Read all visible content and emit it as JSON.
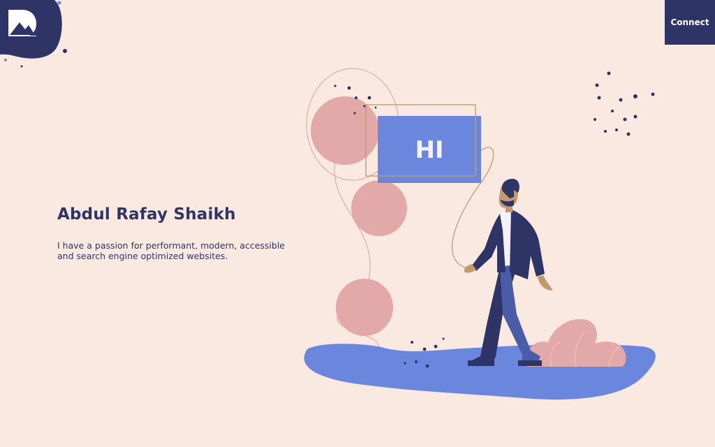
{
  "header": {
    "logo_icon": "mountain-logo-icon",
    "connect_label": "Connect"
  },
  "hero": {
    "name": "Abdul Rafay Shaikh",
    "description": "I have a passion for performant, modern, accessible and search engine optimized websites."
  },
  "illustration": {
    "greeting": "HI"
  },
  "colors": {
    "background": "#f9e9e0",
    "navy": "#2e3466",
    "periwinkle": "#6b87dd",
    "pink": "#e3a8a8",
    "tan": "#c49a6c"
  }
}
